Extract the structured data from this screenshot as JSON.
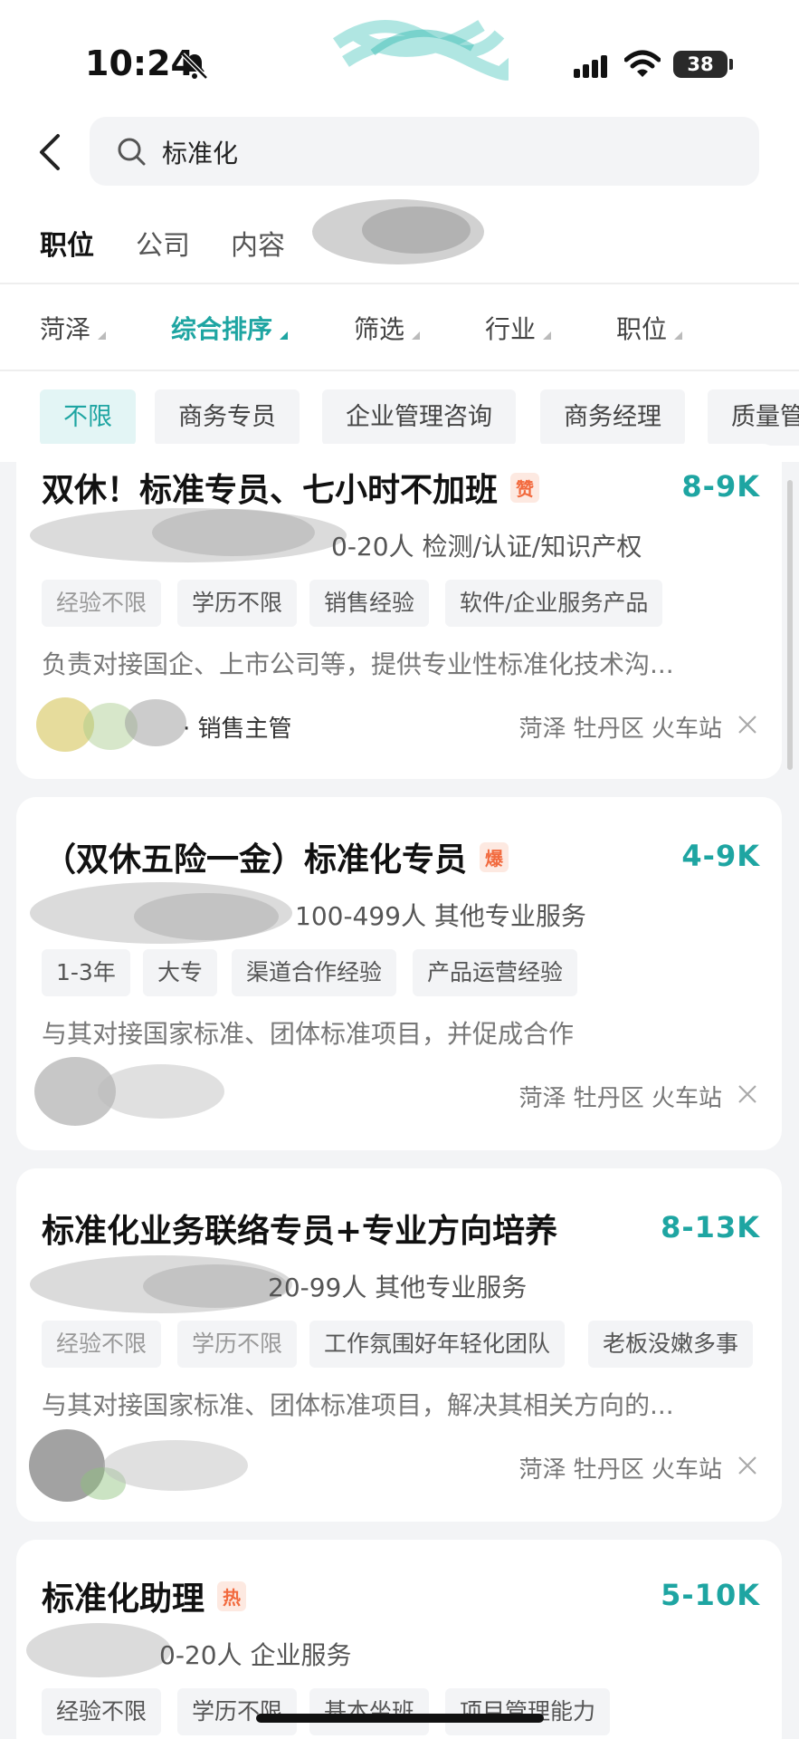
{
  "status_bar": {
    "time": "10:24",
    "battery": "38"
  },
  "search": {
    "query": "标准化"
  },
  "tabs": [
    {
      "label": "职位",
      "active": true
    },
    {
      "label": "公司",
      "active": false
    },
    {
      "label": "内容",
      "active": false
    }
  ],
  "filters": [
    {
      "label": "菏泽",
      "active": false
    },
    {
      "label": "综合排序",
      "active": true
    },
    {
      "label": "筛选",
      "active": false
    },
    {
      "label": "行业",
      "active": false
    },
    {
      "label": "职位",
      "active": false
    }
  ],
  "chips": [
    {
      "label": "不限",
      "active": true
    },
    {
      "label": "商务专员",
      "active": false
    },
    {
      "label": "企业管理咨询",
      "active": false
    },
    {
      "label": "商务经理",
      "active": false
    },
    {
      "label": "质量管",
      "active": false
    }
  ],
  "jobs": [
    {
      "title": "双休！标准专员、七小时不加班",
      "badge": "赞",
      "salary": "8-9K",
      "company_info": "0-20人 检测/认证/知识产权",
      "tags": [
        "经验不限",
        "学历不限",
        "销售经验",
        "软件/企业服务产品"
      ],
      "description": "负责对接国企、上市公司等，提供专业性标准化技术沟...",
      "recruiter": "· 销售主管",
      "location": "菏泽 牡丹区 火车站"
    },
    {
      "title": "（双休五险一金）标准化专员",
      "badge": "爆",
      "salary": "4-9K",
      "company_info": "100-499人 其他专业服务",
      "tags": [
        "1-3年",
        "大专",
        "渠道合作经验",
        "产品运营经验"
      ],
      "description": "与其对接国家标准、团体标准项目，并促成合作",
      "recruiter": "",
      "location": "菏泽 牡丹区 火车站"
    },
    {
      "title": "标准化业务联络专员+专业方向培养",
      "badge": "",
      "salary": "8-13K",
      "company_info": "20-99人 其他专业服务",
      "tags": [
        "经验不限",
        "学历不限",
        "工作氛围好年轻化团队",
        "老板没嫩多事"
      ],
      "description": "与其对接国家标准、团体标准项目，解决其相关方向的...",
      "recruiter": "",
      "location": "菏泽 牡丹区 火车站"
    },
    {
      "title": "标准化助理",
      "badge": "热",
      "salary": "5-10K",
      "company_info": "0-20人 企业服务",
      "tags": [
        "经验不限",
        "学历不限",
        "基本坐班",
        "项目管理能力"
      ],
      "description": "",
      "recruiter": "",
      "location": ""
    }
  ]
}
